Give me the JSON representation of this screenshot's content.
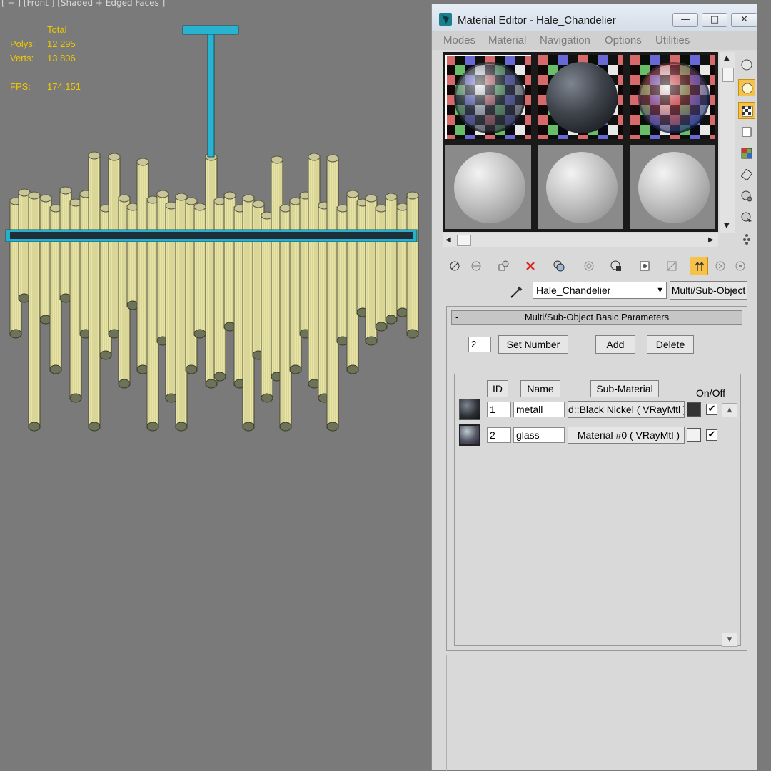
{
  "viewport": {
    "label": "[ + ] [Front ] [Shaded + Edged Faces ]",
    "stats": {
      "total_label": "Total",
      "polys_label": "Polys:",
      "polys_value": "12 295",
      "verts_label": "Verts:",
      "verts_value": "13 806",
      "fps_label": "FPS:",
      "fps_value": "174,151"
    },
    "colors": {
      "stats": "#f0c800",
      "wire": "#e8e4a6",
      "frame": "#28b4d0"
    }
  },
  "editor": {
    "title": "Material Editor - Hale_Chandelier",
    "window_buttons": {
      "minimize": "—",
      "maximize": "□",
      "close": "✕"
    },
    "menu": [
      "Modes",
      "Material",
      "Navigation",
      "Options",
      "Utilities"
    ],
    "sample_slots": [
      {
        "icon": "glass-sphere-icon"
      },
      {
        "icon": "black-nickel-sphere-icon"
      },
      {
        "icon": "glass-sphere-icon"
      },
      {
        "icon": "default-sphere-icon"
      },
      {
        "icon": "default-sphere-icon"
      },
      {
        "icon": "default-sphere-icon"
      }
    ],
    "material_name": "Hale_Chandelier",
    "material_type": "Multi/Sub-Object",
    "rollout_title": "Multi/Sub-Object Basic Parameters",
    "rollout_toggle": "-",
    "number_value": "2",
    "buttons": {
      "set_number": "Set Number",
      "add": "Add",
      "delete": "Delete"
    },
    "columns": {
      "id": "ID",
      "name": "Name",
      "sub_material": "Sub-Material",
      "on_off": "On/Off"
    },
    "rows": [
      {
        "id": "1",
        "name": "metall",
        "sub_material": "d::Black Nickel  ( VRayMtl )",
        "swatch": "#333333",
        "checked": "✔"
      },
      {
        "id": "2",
        "name": "glass",
        "sub_material": "Material #0  ( VRayMtl )",
        "swatch": "#f2f2f2",
        "checked": "✔"
      }
    ],
    "colors": {
      "accent": "#f6c24a",
      "panel": "#d9d9d9"
    }
  }
}
